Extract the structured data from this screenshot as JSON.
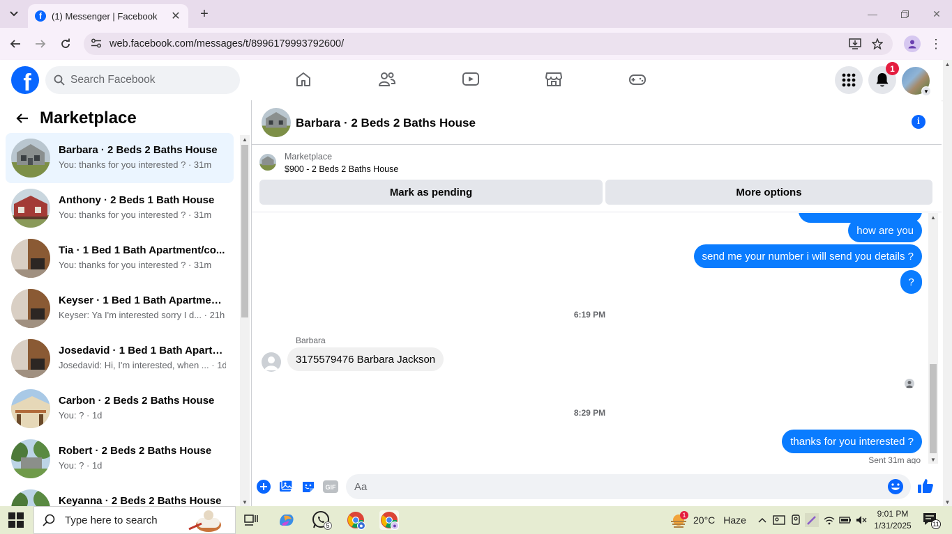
{
  "browser": {
    "tab_title": "(1) Messenger | Facebook",
    "tab_favicon": "f",
    "url": "web.facebook.com/messages/t/8996179993792600/"
  },
  "fb": {
    "logo_letter": "f",
    "search_placeholder": "Search Facebook",
    "notification_count": "1"
  },
  "sidebar": {
    "title": "Marketplace",
    "conversations": [
      {
        "name": "Barbara · 2 Beds 2 Baths House",
        "snippet": "You: thanks for you interested ? · 31m",
        "thumb": "house-green"
      },
      {
        "name": "Anthony · 2 Beds 1 Bath House",
        "snippet": "You: thanks for you interested ? · 31m",
        "thumb": "house-red"
      },
      {
        "name": "Tia · 1 Bed 1 Bath Apartment/co...",
        "snippet": "You: thanks for you interested ? · 31m",
        "thumb": "room-wood"
      },
      {
        "name": "Keyser · 1 Bed 1 Bath Apartment...",
        "snippet": "Keyser: Ya I'm interested sorry I d...  · 21h",
        "thumb": "room-wood"
      },
      {
        "name": "Josedavid · 1 Bed 1 Bath Apartm...",
        "snippet": "Josedavid: Hi, I'm interested, when ... · 1d",
        "thumb": "room-wood"
      },
      {
        "name": "Carbon · 2 Beds 2 Baths House",
        "snippet": "You: ? · 1d",
        "thumb": "house-porch"
      },
      {
        "name": "Robert · 2 Beds 2 Baths House",
        "snippet": "You: ? · 1d",
        "thumb": "house-trees"
      },
      {
        "name": "Keyanna · 2 Beds 2 Baths House",
        "snippet": "",
        "thumb": "house-trees"
      }
    ]
  },
  "chat": {
    "title": "Barbara · 2 Beds 2 Baths House",
    "marketplace_label": "Marketplace",
    "listing": "$900 - 2 Beds 2 Baths House",
    "btn_pending": "Mark as pending",
    "btn_more": "More options",
    "messages": {
      "out1": "how are you",
      "out2": "send me your number i will send you details ?",
      "out3": "?",
      "time1": "6:19 PM",
      "sender": "Barbara",
      "in1": "3175579476 Barbara Jackson",
      "time2": "8:29 PM",
      "out4": "thanks for you interested ?",
      "status": "Sent 31m ago"
    },
    "composer_placeholder": "Aa"
  },
  "taskbar": {
    "search_placeholder": "Type here to search",
    "whatsapp_count": "5",
    "weather_badge": "1",
    "temperature": "20°C",
    "condition": "Haze",
    "time": "9:01 PM",
    "date": "1/31/2025",
    "notifications": "11"
  }
}
